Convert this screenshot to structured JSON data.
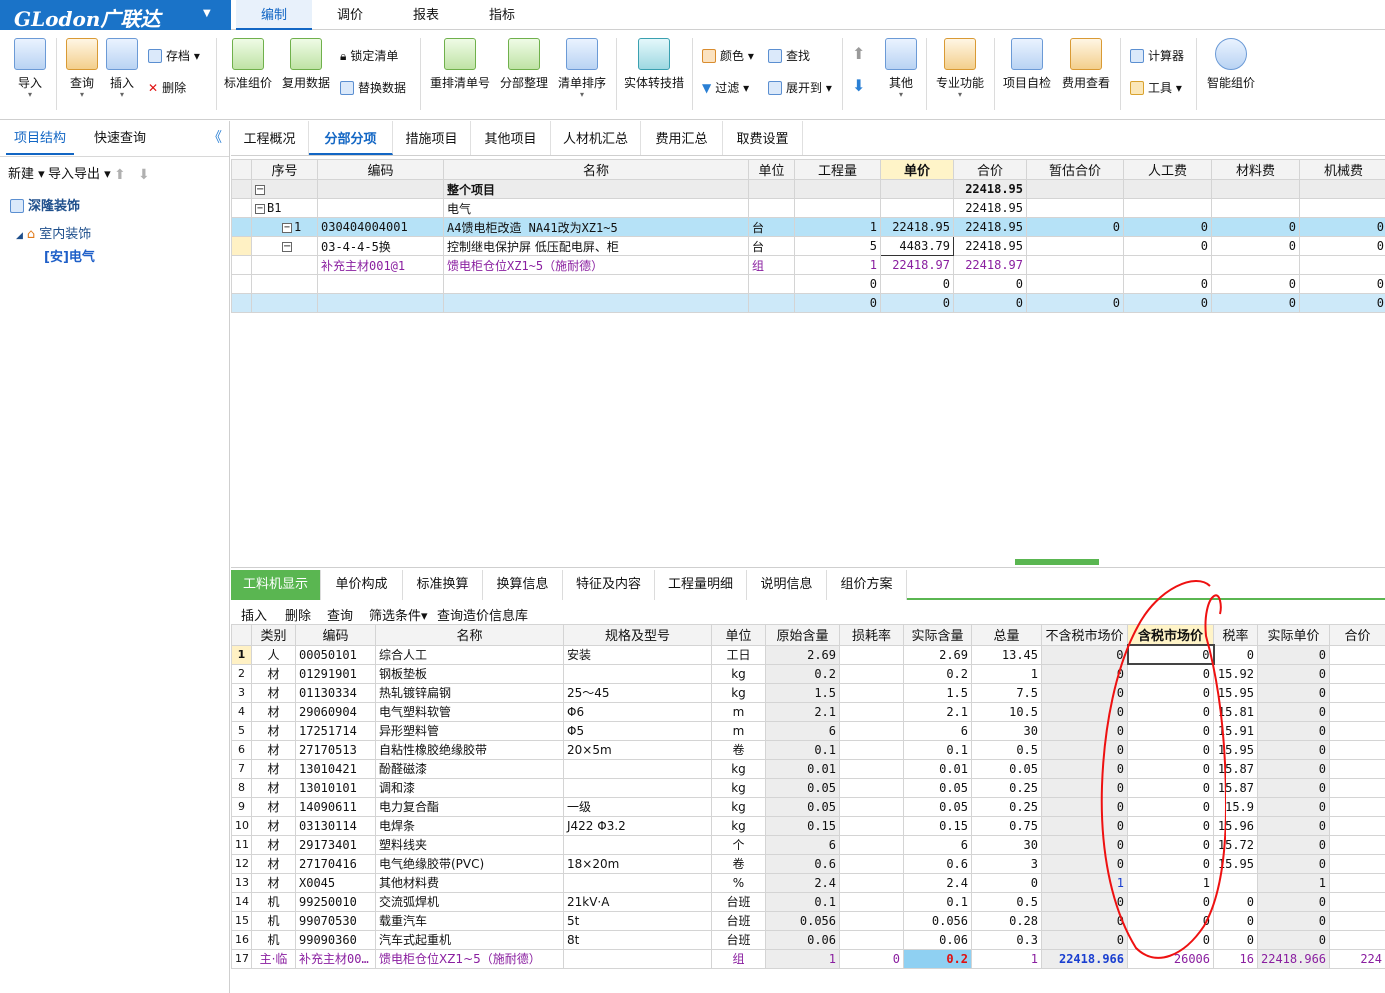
{
  "app": {
    "brand": "GLodon广联达"
  },
  "menu_tabs": [
    "编制",
    "调价",
    "报表",
    "指标"
  ],
  "ribbon": {
    "import": "导入",
    "query": "查询",
    "insert": "插入",
    "save": "存档",
    "delete": "删除",
    "std_price": "标准组价",
    "reuse": "复用数据",
    "lock": "锁定清单",
    "replace": "替换数据",
    "renumber": "重排清单号",
    "section_sort": "分部整理",
    "list_sort": "清单排序",
    "convert": "实体转技措",
    "color": "颜色",
    "find": "查找",
    "filter": "过滤",
    "expand": "展开到",
    "other": "其他",
    "pro": "专业功能",
    "self_check": "项目自检",
    "cost_view": "费用查看",
    "calc": "计算器",
    "tools": "工具",
    "smart": "智能组价"
  },
  "left": {
    "tabs": [
      "项目结构",
      "快速查询"
    ],
    "toolbar": {
      "new": "新建",
      "io": "导入导出"
    },
    "tree": {
      "root": "深隆装饰",
      "child": "室内装饰",
      "leaf": "[安]电气"
    }
  },
  "main_tabs": [
    "工程概况",
    "分部分项",
    "措施项目",
    "其他项目",
    "人材机汇总",
    "费用汇总",
    "取费设置"
  ],
  "top_grid": {
    "headers": [
      "序号",
      "编码",
      "名称",
      "单位",
      "工程量",
      "单价",
      "合价",
      "暂估合价",
      "人工费",
      "材料费",
      "机械费"
    ],
    "rows": [
      {
        "seq": "",
        "code": "",
        "name": "整个项目",
        "unit": "",
        "qty": "",
        "price": "",
        "total": "22418.95",
        "est": "",
        "labor": "",
        "mat": "",
        "mach": ""
      },
      {
        "seq": "B1",
        "code": "",
        "name": "电气",
        "unit": "",
        "qty": "",
        "price": "",
        "total": "22418.95",
        "est": "",
        "labor": "",
        "mat": "",
        "mach": ""
      },
      {
        "seq": "1",
        "code": "030404004001",
        "name": "A4馈电柜改造 NA41改为XZ1~5",
        "unit": "台",
        "qty": "1",
        "price": "22418.95",
        "total": "22418.95",
        "est": "0",
        "labor": "0",
        "mat": "0",
        "mach": "0"
      },
      {
        "seq": "",
        "code": "03-4-4-5换",
        "name": "控制继电保护屏 低压配电屏、柜",
        "unit": "台",
        "qty": "5",
        "price": "4483.79",
        "total": "22418.95",
        "est": "",
        "labor": "0",
        "mat": "0",
        "mach": "0"
      },
      {
        "seq": "",
        "code": "补充主材001@1",
        "name": "馈电柜仓位XZ1~5（施耐德）",
        "unit": "组",
        "qty": "1",
        "price": "22418.97",
        "total": "22418.97",
        "est": "",
        "labor": "",
        "mat": "",
        "mach": ""
      },
      {
        "seq": "",
        "code": "",
        "name": "",
        "unit": "",
        "qty": "0",
        "price": "0",
        "total": "0",
        "est": "",
        "labor": "0",
        "mat": "0",
        "mach": "0"
      },
      {
        "seq": "",
        "code": "",
        "name": "",
        "unit": "",
        "qty": "0",
        "price": "0",
        "total": "0",
        "est": "0",
        "labor": "0",
        "mat": "0",
        "mach": "0"
      }
    ]
  },
  "bottom_tabs": [
    "工料机显示",
    "单价构成",
    "标准换算",
    "换算信息",
    "特征及内容",
    "工程量明细",
    "说明信息",
    "组价方案"
  ],
  "bottom_toolbar": [
    "插入",
    "删除",
    "查询",
    "筛选条件",
    "查询造价信息库"
  ],
  "bottom_grid": {
    "headers": [
      "类别",
      "编码",
      "名称",
      "规格及型号",
      "单位",
      "原始含量",
      "损耗率",
      "实际含量",
      "总量",
      "不含税市场价",
      "含税市场价",
      "税率",
      "实际单价",
      "合价"
    ],
    "rows": [
      {
        "n": "1",
        "cat": "人",
        "code": "00050101",
        "name": "综合人工",
        "spec": "安装",
        "unit": "工日",
        "orig": "2.69",
        "loss": "",
        "act": "2.69",
        "total": "13.45",
        "ntax": "0",
        "tax": "0",
        "rate": "0",
        "price": "0"
      },
      {
        "n": "2",
        "cat": "材",
        "code": "01291901",
        "name": "钢板垫板",
        "spec": "",
        "unit": "kg",
        "orig": "0.2",
        "loss": "",
        "act": "0.2",
        "total": "1",
        "ntax": "0",
        "tax": "0",
        "rate": "15.92",
        "price": "0"
      },
      {
        "n": "3",
        "cat": "材",
        "code": "01130334",
        "name": "热轧镀锌扁钢",
        "spec": "25～45",
        "unit": "kg",
        "orig": "1.5",
        "loss": "",
        "act": "1.5",
        "total": "7.5",
        "ntax": "0",
        "tax": "0",
        "rate": "15.95",
        "price": "0"
      },
      {
        "n": "4",
        "cat": "材",
        "code": "29060904",
        "name": "电气塑料软管",
        "spec": "Φ6",
        "unit": "m",
        "orig": "2.1",
        "loss": "",
        "act": "2.1",
        "total": "10.5",
        "ntax": "0",
        "tax": "0",
        "rate": "15.81",
        "price": "0"
      },
      {
        "n": "5",
        "cat": "材",
        "code": "17251714",
        "name": "异形塑料管",
        "spec": "Φ5",
        "unit": "m",
        "orig": "6",
        "loss": "",
        "act": "6",
        "total": "30",
        "ntax": "0",
        "tax": "0",
        "rate": "15.91",
        "price": "0"
      },
      {
        "n": "6",
        "cat": "材",
        "code": "27170513",
        "name": "自粘性橡胶绝缘胶带",
        "spec": "20×5m",
        "unit": "卷",
        "orig": "0.1",
        "loss": "",
        "act": "0.1",
        "total": "0.5",
        "ntax": "0",
        "tax": "0",
        "rate": "15.95",
        "price": "0"
      },
      {
        "n": "7",
        "cat": "材",
        "code": "13010421",
        "name": "酚醛磁漆",
        "spec": "",
        "unit": "kg",
        "orig": "0.01",
        "loss": "",
        "act": "0.01",
        "total": "0.05",
        "ntax": "0",
        "tax": "0",
        "rate": "15.87",
        "price": "0"
      },
      {
        "n": "8",
        "cat": "材",
        "code": "13010101",
        "name": "调和漆",
        "spec": "",
        "unit": "kg",
        "orig": "0.05",
        "loss": "",
        "act": "0.05",
        "total": "0.25",
        "ntax": "0",
        "tax": "0",
        "rate": "15.87",
        "price": "0"
      },
      {
        "n": "9",
        "cat": "材",
        "code": "14090611",
        "name": "电力复合酯",
        "spec": "一级",
        "unit": "kg",
        "orig": "0.05",
        "loss": "",
        "act": "0.05",
        "total": "0.25",
        "ntax": "0",
        "tax": "0",
        "rate": "15.9",
        "price": "0"
      },
      {
        "n": "10",
        "cat": "材",
        "code": "03130114",
        "name": "电焊条",
        "spec": "J422 Φ3.2",
        "unit": "kg",
        "orig": "0.15",
        "loss": "",
        "act": "0.15",
        "total": "0.75",
        "ntax": "0",
        "tax": "0",
        "rate": "15.96",
        "price": "0"
      },
      {
        "n": "11",
        "cat": "材",
        "code": "29173401",
        "name": "塑料线夹",
        "spec": "",
        "unit": "个",
        "orig": "6",
        "loss": "",
        "act": "6",
        "total": "30",
        "ntax": "0",
        "tax": "0",
        "rate": "15.72",
        "price": "0"
      },
      {
        "n": "12",
        "cat": "材",
        "code": "27170416",
        "name": "电气绝缘胶带(PVC)",
        "spec": "18×20m",
        "unit": "卷",
        "orig": "0.6",
        "loss": "",
        "act": "0.6",
        "total": "3",
        "ntax": "0",
        "tax": "0",
        "rate": "15.95",
        "price": "0"
      },
      {
        "n": "13",
        "cat": "材",
        "code": "X0045",
        "name": "其他材料费",
        "spec": "",
        "unit": "%",
        "orig": "2.4",
        "loss": "",
        "act": "2.4",
        "total": "0",
        "ntax": "1",
        "tax": "1",
        "rate": "",
        "price": "1"
      },
      {
        "n": "14",
        "cat": "机",
        "code": "99250010",
        "name": "交流弧焊机",
        "spec": "21kV·A",
        "unit": "台班",
        "orig": "0.1",
        "loss": "",
        "act": "0.1",
        "total": "0.5",
        "ntax": "0",
        "tax": "0",
        "rate": "0",
        "price": "0"
      },
      {
        "n": "15",
        "cat": "机",
        "code": "99070530",
        "name": "载重汽车",
        "spec": "5t",
        "unit": "台班",
        "orig": "0.056",
        "loss": "",
        "act": "0.056",
        "total": "0.28",
        "ntax": "0",
        "tax": "0",
        "rate": "0",
        "price": "0"
      },
      {
        "n": "16",
        "cat": "机",
        "code": "99090360",
        "name": "汽车式起重机",
        "spec": "8t",
        "unit": "台班",
        "orig": "0.06",
        "loss": "",
        "act": "0.06",
        "total": "0.3",
        "ntax": "0",
        "tax": "0",
        "rate": "0",
        "price": "0"
      },
      {
        "n": "17",
        "cat": "主·临",
        "code": "补充主材00…",
        "name": "馈电柜仓位XZ1~5（施耐德）",
        "spec": "",
        "unit": "组",
        "orig": "1",
        "loss": "0",
        "act": "0.2",
        "total": "1",
        "ntax": "22418.966",
        "tax": "26006",
        "rate": "16",
        "price": "22418.966",
        "sum": "224"
      }
    ]
  }
}
